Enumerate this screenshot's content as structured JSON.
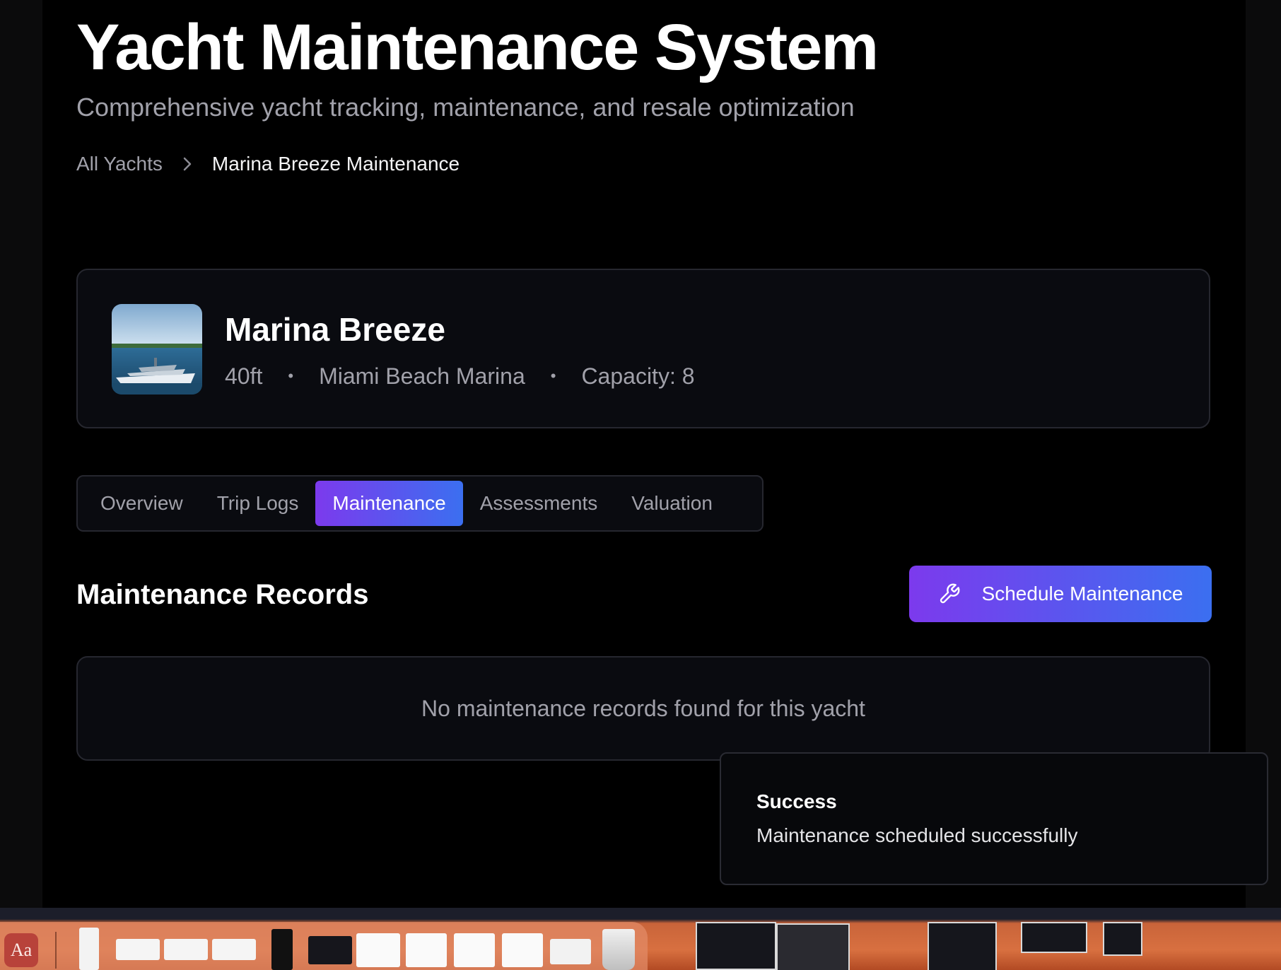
{
  "header": {
    "title": "Yacht Maintenance System",
    "subtitle": "Comprehensive yacht tracking, maintenance, and resale optimization"
  },
  "breadcrumb": {
    "parent": "All Yachts",
    "current": "Marina Breeze Maintenance"
  },
  "yacht": {
    "name": "Marina Breeze",
    "length": "40ft",
    "location": "Miami Beach Marina",
    "capacity": "Capacity: 8",
    "separator": "•"
  },
  "tabs": [
    {
      "label": "Overview",
      "active": false
    },
    {
      "label": "Trip Logs",
      "active": false
    },
    {
      "label": "Maintenance",
      "active": true
    },
    {
      "label": "Assessments",
      "active": false
    },
    {
      "label": "Valuation",
      "active": false
    }
  ],
  "section": {
    "title": "Maintenance Records",
    "schedule_button": "Schedule Maintenance",
    "schedule_icon": "wrench-icon",
    "empty_message": "No maintenance records found for this yacht"
  },
  "toast": {
    "title": "Success",
    "message": "Maintenance scheduled successfully"
  },
  "dock": {
    "dictionary_label": "Aa"
  },
  "colors": {
    "background": "#000000",
    "card": "#0a0b10",
    "border": "#26272f",
    "muted_text": "#a1a1aa",
    "accent_start": "#7c3aed",
    "accent_end": "#3b6ff0"
  }
}
